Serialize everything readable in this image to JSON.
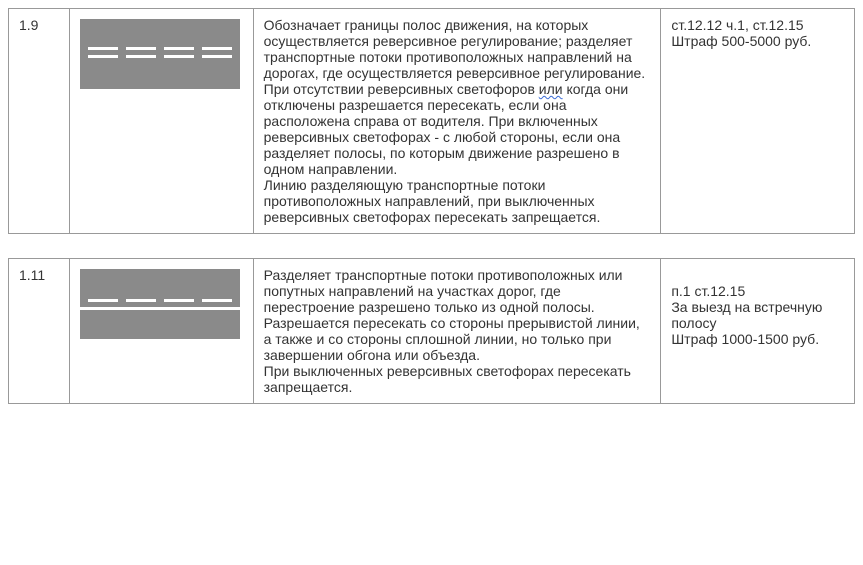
{
  "rows": [
    {
      "num": "1.9",
      "desc_before": "Обозначает границы полос движения, на которых осуществляется реверсивное регулирование; разделяет транспортные потоки противоположных направлений на дорогах, где осуществляется реверсивное регулирование. При отсутствии реверсивных светофоров ",
      "desc_wave": "или",
      "desc_after": " когда они отключены разрешается пересекать, если она расположена справа от водителя. При включенных реверсивных светофорах - с любой стороны, если она разделяет полосы, по которым движение разрешено в одном направлении.",
      "desc_p2": "Линию разделяющую транспортные потоки противоположных направлений, при выключенных реверсивных светофорах пересекать запрещается.",
      "penalty_l1": "ст.12.12 ч.1, ст.12.15",
      "penalty_l2": "Штраф 500-5000 руб."
    },
    {
      "num": "1.11",
      "desc_p1": "Разделяет транспортные потоки противоположных или попутных направлений на участках дорог, где перестроение разрешено только из одной полосы. Разрешается пересекать со стороны прерывистой линии, а также и со стороны сплошной линии, но только при завершении обгона или объезда.",
      "desc_p2": "При выключенных реверсивных светофорах пересекать запрещается.",
      "penalty_l1": "п.1 ст.12.15",
      "penalty_l2": "За выезд на встречную полосу",
      "penalty_l3": "Штраф 1000-1500 руб."
    }
  ]
}
